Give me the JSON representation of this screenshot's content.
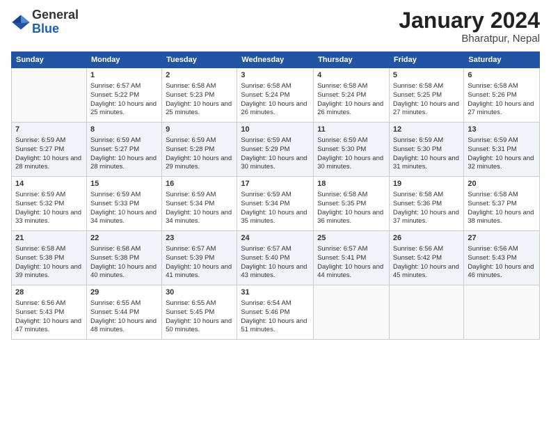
{
  "header": {
    "logo_line1": "General",
    "logo_line2": "Blue",
    "month": "January 2024",
    "location": "Bharatpur, Nepal"
  },
  "days_of_week": [
    "Sunday",
    "Monday",
    "Tuesday",
    "Wednesday",
    "Thursday",
    "Friday",
    "Saturday"
  ],
  "weeks": [
    [
      {
        "day": "",
        "sunrise": "",
        "sunset": "",
        "daylight": ""
      },
      {
        "day": "1",
        "sunrise": "Sunrise: 6:57 AM",
        "sunset": "Sunset: 5:22 PM",
        "daylight": "Daylight: 10 hours and 25 minutes."
      },
      {
        "day": "2",
        "sunrise": "Sunrise: 6:58 AM",
        "sunset": "Sunset: 5:23 PM",
        "daylight": "Daylight: 10 hours and 25 minutes."
      },
      {
        "day": "3",
        "sunrise": "Sunrise: 6:58 AM",
        "sunset": "Sunset: 5:24 PM",
        "daylight": "Daylight: 10 hours and 26 minutes."
      },
      {
        "day": "4",
        "sunrise": "Sunrise: 6:58 AM",
        "sunset": "Sunset: 5:24 PM",
        "daylight": "Daylight: 10 hours and 26 minutes."
      },
      {
        "day": "5",
        "sunrise": "Sunrise: 6:58 AM",
        "sunset": "Sunset: 5:25 PM",
        "daylight": "Daylight: 10 hours and 27 minutes."
      },
      {
        "day": "6",
        "sunrise": "Sunrise: 6:58 AM",
        "sunset": "Sunset: 5:26 PM",
        "daylight": "Daylight: 10 hours and 27 minutes."
      }
    ],
    [
      {
        "day": "7",
        "sunrise": "Sunrise: 6:59 AM",
        "sunset": "Sunset: 5:27 PM",
        "daylight": "Daylight: 10 hours and 28 minutes."
      },
      {
        "day": "8",
        "sunrise": "Sunrise: 6:59 AM",
        "sunset": "Sunset: 5:27 PM",
        "daylight": "Daylight: 10 hours and 28 minutes."
      },
      {
        "day": "9",
        "sunrise": "Sunrise: 6:59 AM",
        "sunset": "Sunset: 5:28 PM",
        "daylight": "Daylight: 10 hours and 29 minutes."
      },
      {
        "day": "10",
        "sunrise": "Sunrise: 6:59 AM",
        "sunset": "Sunset: 5:29 PM",
        "daylight": "Daylight: 10 hours and 30 minutes."
      },
      {
        "day": "11",
        "sunrise": "Sunrise: 6:59 AM",
        "sunset": "Sunset: 5:30 PM",
        "daylight": "Daylight: 10 hours and 30 minutes."
      },
      {
        "day": "12",
        "sunrise": "Sunrise: 6:59 AM",
        "sunset": "Sunset: 5:30 PM",
        "daylight": "Daylight: 10 hours and 31 minutes."
      },
      {
        "day": "13",
        "sunrise": "Sunrise: 6:59 AM",
        "sunset": "Sunset: 5:31 PM",
        "daylight": "Daylight: 10 hours and 32 minutes."
      }
    ],
    [
      {
        "day": "14",
        "sunrise": "Sunrise: 6:59 AM",
        "sunset": "Sunset: 5:32 PM",
        "daylight": "Daylight: 10 hours and 33 minutes."
      },
      {
        "day": "15",
        "sunrise": "Sunrise: 6:59 AM",
        "sunset": "Sunset: 5:33 PM",
        "daylight": "Daylight: 10 hours and 34 minutes."
      },
      {
        "day": "16",
        "sunrise": "Sunrise: 6:59 AM",
        "sunset": "Sunset: 5:34 PM",
        "daylight": "Daylight: 10 hours and 34 minutes."
      },
      {
        "day": "17",
        "sunrise": "Sunrise: 6:59 AM",
        "sunset": "Sunset: 5:34 PM",
        "daylight": "Daylight: 10 hours and 35 minutes."
      },
      {
        "day": "18",
        "sunrise": "Sunrise: 6:58 AM",
        "sunset": "Sunset: 5:35 PM",
        "daylight": "Daylight: 10 hours and 36 minutes."
      },
      {
        "day": "19",
        "sunrise": "Sunrise: 6:58 AM",
        "sunset": "Sunset: 5:36 PM",
        "daylight": "Daylight: 10 hours and 37 minutes."
      },
      {
        "day": "20",
        "sunrise": "Sunrise: 6:58 AM",
        "sunset": "Sunset: 5:37 PM",
        "daylight": "Daylight: 10 hours and 38 minutes."
      }
    ],
    [
      {
        "day": "21",
        "sunrise": "Sunrise: 6:58 AM",
        "sunset": "Sunset: 5:38 PM",
        "daylight": "Daylight: 10 hours and 39 minutes."
      },
      {
        "day": "22",
        "sunrise": "Sunrise: 6:58 AM",
        "sunset": "Sunset: 5:38 PM",
        "daylight": "Daylight: 10 hours and 40 minutes."
      },
      {
        "day": "23",
        "sunrise": "Sunrise: 6:57 AM",
        "sunset": "Sunset: 5:39 PM",
        "daylight": "Daylight: 10 hours and 41 minutes."
      },
      {
        "day": "24",
        "sunrise": "Sunrise: 6:57 AM",
        "sunset": "Sunset: 5:40 PM",
        "daylight": "Daylight: 10 hours and 43 minutes."
      },
      {
        "day": "25",
        "sunrise": "Sunrise: 6:57 AM",
        "sunset": "Sunset: 5:41 PM",
        "daylight": "Daylight: 10 hours and 44 minutes."
      },
      {
        "day": "26",
        "sunrise": "Sunrise: 6:56 AM",
        "sunset": "Sunset: 5:42 PM",
        "daylight": "Daylight: 10 hours and 45 minutes."
      },
      {
        "day": "27",
        "sunrise": "Sunrise: 6:56 AM",
        "sunset": "Sunset: 5:43 PM",
        "daylight": "Daylight: 10 hours and 46 minutes."
      }
    ],
    [
      {
        "day": "28",
        "sunrise": "Sunrise: 6:56 AM",
        "sunset": "Sunset: 5:43 PM",
        "daylight": "Daylight: 10 hours and 47 minutes."
      },
      {
        "day": "29",
        "sunrise": "Sunrise: 6:55 AM",
        "sunset": "Sunset: 5:44 PM",
        "daylight": "Daylight: 10 hours and 48 minutes."
      },
      {
        "day": "30",
        "sunrise": "Sunrise: 6:55 AM",
        "sunset": "Sunset: 5:45 PM",
        "daylight": "Daylight: 10 hours and 50 minutes."
      },
      {
        "day": "31",
        "sunrise": "Sunrise: 6:54 AM",
        "sunset": "Sunset: 5:46 PM",
        "daylight": "Daylight: 10 hours and 51 minutes."
      },
      {
        "day": "",
        "sunrise": "",
        "sunset": "",
        "daylight": ""
      },
      {
        "day": "",
        "sunrise": "",
        "sunset": "",
        "daylight": ""
      },
      {
        "day": "",
        "sunrise": "",
        "sunset": "",
        "daylight": ""
      }
    ]
  ]
}
